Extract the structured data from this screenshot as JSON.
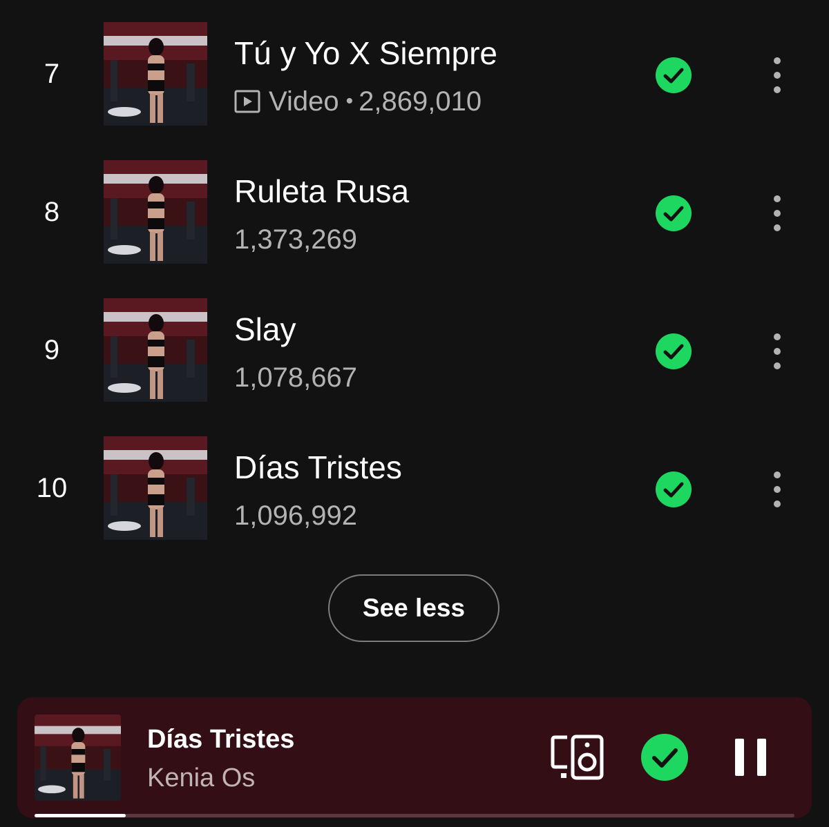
{
  "tracks": [
    {
      "rank": "7",
      "title": "Tú y Yo X Siempre",
      "has_video": true,
      "video_label": "Video",
      "separator": "•",
      "plays": "2,869,010",
      "saved": true
    },
    {
      "rank": "8",
      "title": "Ruleta Rusa",
      "has_video": false,
      "plays": "1,373,269",
      "saved": true
    },
    {
      "rank": "9",
      "title": "Slay",
      "has_video": false,
      "plays": "1,078,667",
      "saved": true
    },
    {
      "rank": "10",
      "title": "Días Tristes",
      "has_video": false,
      "plays": "1,096,992",
      "saved": true
    }
  ],
  "see_less_label": "See less",
  "now_playing": {
    "title": "Días Tristes",
    "artist": "Kenia Os",
    "saved": true,
    "is_playing": true,
    "progress_fraction": 0.12
  },
  "icons": {
    "video": "video-badge-icon",
    "saved": "check-circle-icon",
    "more": "more-vertical-icon",
    "devices": "connect-devices-icon",
    "pause": "pause-icon"
  },
  "colors": {
    "background": "#121212",
    "accent_green": "#1ed760",
    "text_primary": "#ffffff",
    "text_secondary": "#b3b3b3",
    "player_background": "#330e14"
  }
}
